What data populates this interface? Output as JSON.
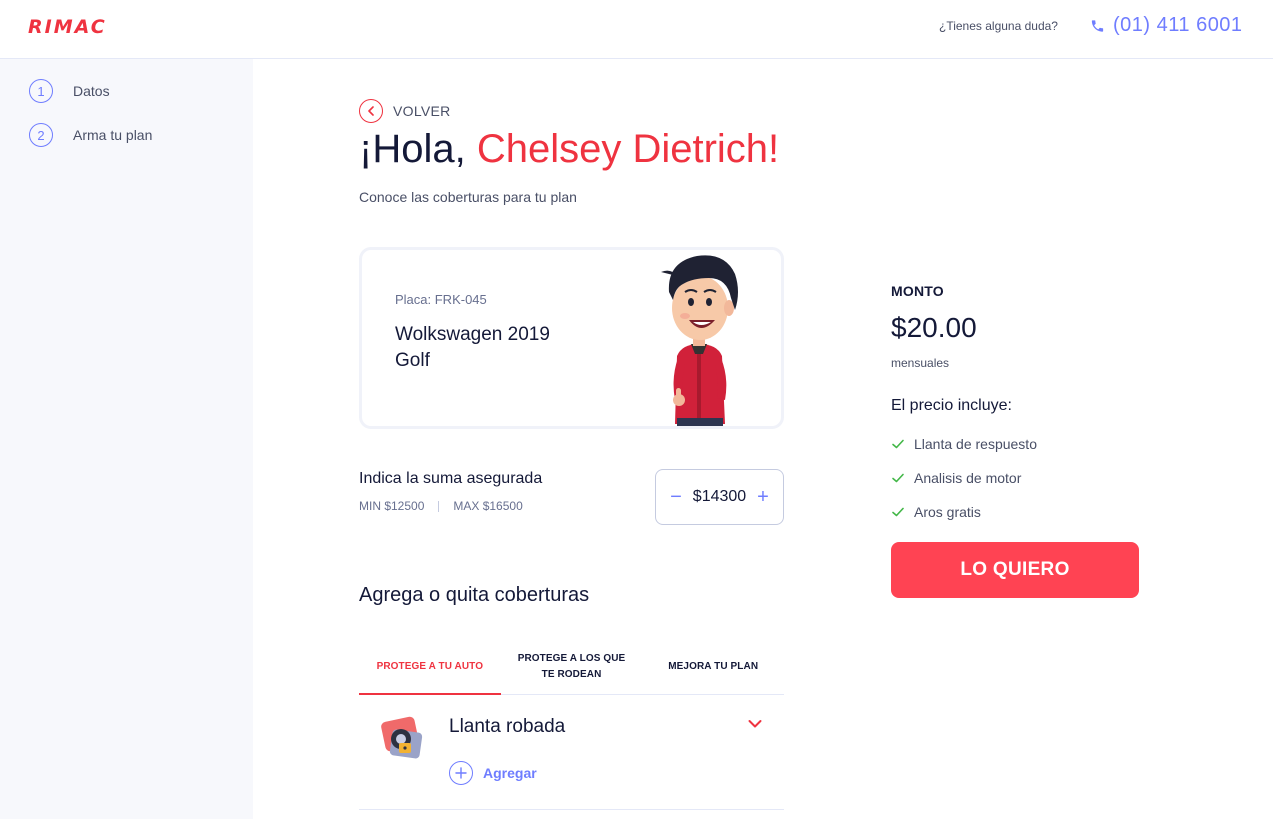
{
  "header": {
    "logo": "RIMAC",
    "help_text": "¿Tienes alguna duda?",
    "phone": "(01) 411 6001",
    "phone_icon": "phone-icon"
  },
  "sidebar": {
    "steps": [
      {
        "number": "1",
        "label": "Datos"
      },
      {
        "number": "2",
        "label": "Arma tu plan"
      }
    ]
  },
  "main": {
    "back_label": "VOLVER",
    "greeting_prefix": "¡Hola, ",
    "greeting_name": "Chelsey Dietrich!",
    "subtitle": "Conoce las coberturas para tu plan",
    "car": {
      "plate": "Placa: FRK-045",
      "model_line1": "Wolkswagen 2019",
      "model_line2": "Golf"
    },
    "insured_sum": {
      "label": "Indica la suma asegurada",
      "min": "MIN $12500",
      "max": "MAX $16500",
      "value": "$14300",
      "decrement": "−",
      "increment": "+"
    },
    "coverages": {
      "title": "Agrega o quita coberturas",
      "tabs": [
        {
          "label": "PROTEGE A TU AUTO",
          "active": true
        },
        {
          "label_line1": "PROTEGE A LOS QUE",
          "label_line2": "TE RODEAN",
          "active": false
        },
        {
          "label": "MEJORA TU PLAN",
          "active": false
        }
      ],
      "items": [
        {
          "name": "Llanta robada",
          "action": "Agregar",
          "icon": "stolen-tire-icon"
        }
      ]
    }
  },
  "price_panel": {
    "label": "MONTO",
    "amount": "$20.00",
    "period": "mensuales",
    "includes_title": "El precio incluye:",
    "includes": [
      "Llanta de respuesto",
      "Analisis de motor",
      "Aros gratis"
    ],
    "cta": "LO QUIERO"
  },
  "colors": {
    "brand_red": "#EF3340",
    "accent_blue": "#6F7DFF",
    "cta_red": "#FF4353",
    "check_green": "#43B748"
  }
}
